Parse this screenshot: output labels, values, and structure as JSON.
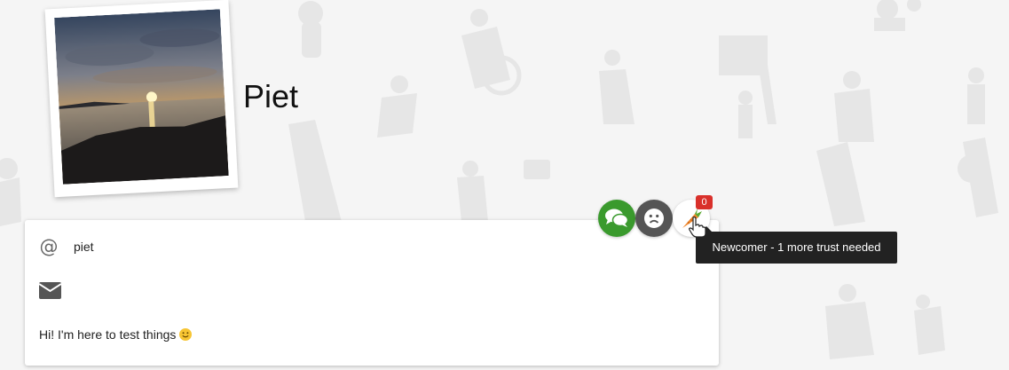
{
  "profile": {
    "name": "Piet",
    "username": "piet",
    "about": "Hi! I'm here to test things",
    "username_icon": "at-icon",
    "email_icon": "envelope-icon",
    "photo_icon": "sunset-photo"
  },
  "actions": [
    {
      "name": "chat-button",
      "icon": "chat-bubbles-icon",
      "color": "#3a9a2d"
    },
    {
      "name": "report-button",
      "icon": "frown-face-icon",
      "color": "#555555"
    },
    {
      "name": "trust-button",
      "icon": "carrot-icon",
      "color": "#ffffff"
    }
  ],
  "trust": {
    "count": "0",
    "tooltip": "Newcomer - 1 more trust needed",
    "badge_color": "#d9302b"
  }
}
